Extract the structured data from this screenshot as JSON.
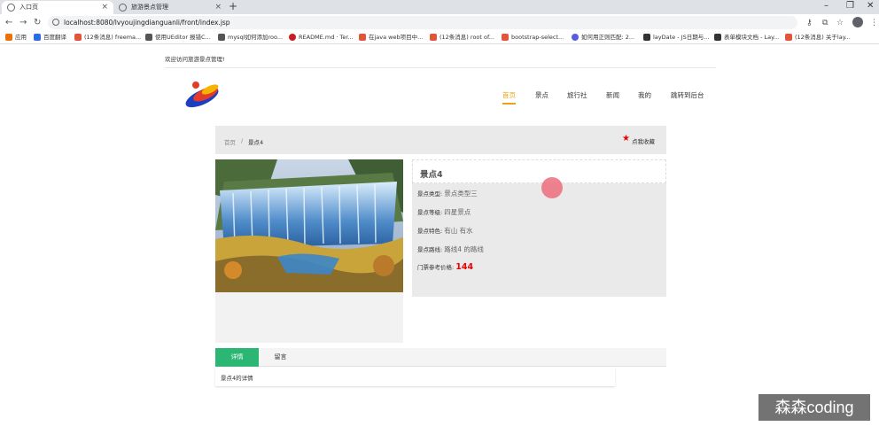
{
  "browser": {
    "tabs": [
      {
        "title": "入口页",
        "active": true
      },
      {
        "title": "旅游景点管理",
        "active": false
      }
    ],
    "url": "localhost:8080/lvyoujingdianguanli/front/index.jsp",
    "bookmarks": [
      {
        "label": "应用",
        "color": "#e8710a"
      },
      {
        "label": "百度翻译",
        "color": "#2b6de0"
      },
      {
        "label": "(12条消息) freema...",
        "color": "#e0553b"
      },
      {
        "label": "使用UEditor 报错C...",
        "color": "#555555"
      },
      {
        "label": "mysql如何添加roo...",
        "color": "#555555"
      },
      {
        "label": "README.md · Ter...",
        "color": "#c71d23"
      },
      {
        "label": "在java web项目中...",
        "color": "#e0553b"
      },
      {
        "label": "(12条消息) root of...",
        "color": "#e0553b"
      },
      {
        "label": "bootstrap-select...",
        "color": "#e0553b"
      },
      {
        "label": "如何用正则匹配: 2...",
        "color": "#5b5be0"
      },
      {
        "label": "layDate - JS日期与...",
        "color": "#333333"
      },
      {
        "label": "表单模块文档 - Lay...",
        "color": "#333333"
      },
      {
        "label": "(12条消息) 关于lay...",
        "color": "#e0553b"
      }
    ]
  },
  "page": {
    "welcome": "欢迎访问旅游景点管理!",
    "nav": [
      {
        "label": "首页",
        "active": true
      },
      {
        "label": "景点",
        "active": false
      },
      {
        "label": "旅行社",
        "active": false
      },
      {
        "label": "新闻",
        "active": false
      },
      {
        "label": "我的",
        "active": false
      },
      {
        "label": "跳转到后台",
        "active": false
      }
    ],
    "breadcrumb": {
      "home": "首页",
      "separator": "/",
      "current": "景点4"
    },
    "favorite_label": "点我收藏",
    "spot": {
      "name": "景点4",
      "type_label": "景点类型:",
      "type_value": "景点类型三",
      "level_label": "景点等级:",
      "level_value": "四星景点",
      "feature_label": "景点特色:",
      "feature_value": "有山 有水",
      "route_label": "景点路线:",
      "route_value": "路线4 的路线",
      "price_label": "门票参考价格:",
      "price_value": "144"
    },
    "tabs": [
      {
        "label": "详情",
        "active": true
      },
      {
        "label": "留言",
        "active": false
      }
    ],
    "detail_text": "景点4的详情"
  },
  "watermark": "森森coding",
  "colors": {
    "accent_nav": "#e8a317",
    "tab_active": "#2bb673",
    "price": "#ee0000",
    "star": "#ee0000"
  }
}
